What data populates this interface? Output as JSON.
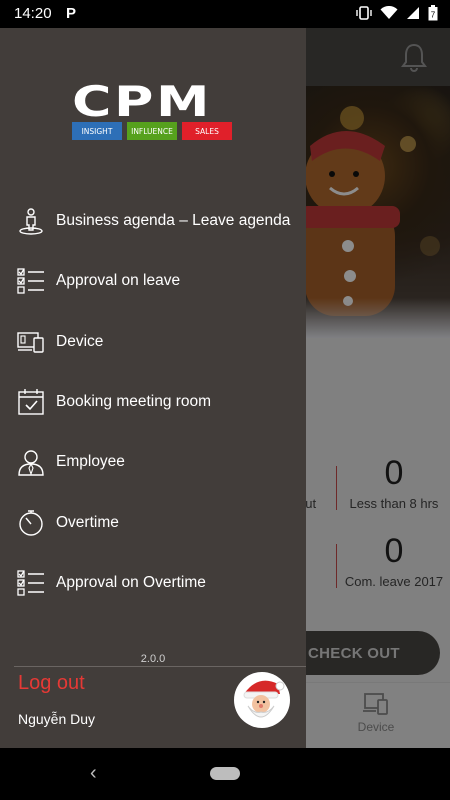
{
  "status_bar": {
    "time": "14:20",
    "app_icon": "P",
    "icons": [
      "vibrate-icon",
      "wifi-icon",
      "signal-icon",
      "battery-icon"
    ]
  },
  "background_app": {
    "stats": [
      {
        "value": "0",
        "label": "Less than 8 hrs",
        "left_partial": "out"
      },
      {
        "value": "0",
        "label": "Com. leave 2017"
      }
    ],
    "checkout_label": "CHECK OUT",
    "nav_device_label": "Device"
  },
  "drawer": {
    "logo": {
      "text": "CPM",
      "tags": [
        "INSIGHT",
        "INFLUENCE",
        "SALES"
      ],
      "tag_colors": [
        "#2d6fb7",
        "#56a11d",
        "#e0202a"
      ]
    },
    "menu": [
      {
        "label": "Business agenda – Leave agenda",
        "icon": "person-location-icon"
      },
      {
        "label": "Approval on leave",
        "icon": "checklist-icon"
      },
      {
        "label": "Device",
        "icon": "devices-icon"
      },
      {
        "label": "Booking meeting room",
        "icon": "calendar-check-icon"
      },
      {
        "label": "Employee",
        "icon": "employee-icon"
      },
      {
        "label": "Overtime",
        "icon": "stopwatch-icon"
      },
      {
        "label": "Approval on Overtime",
        "icon": "checklist-icon"
      }
    ],
    "version": "2.0.0",
    "logout_label": "Log out",
    "user_name": "Nguyễn Duy"
  },
  "colors": {
    "drawer_bg": "#423d3a",
    "logout": "#e53935",
    "accent_divider": "#c84b4b"
  }
}
